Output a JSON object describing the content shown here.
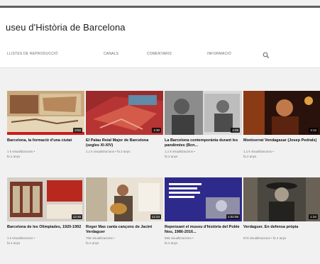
{
  "channel": {
    "title": "useu d'Història de Barcelona"
  },
  "tabs": [
    {
      "label": "LLISTES DE REPRODUCCIÓ"
    },
    {
      "label": "CANALS"
    },
    {
      "label": "COMENTARIS"
    },
    {
      "label": "INFORMACIÓ"
    }
  ],
  "section_label": "",
  "videos": [
    {
      "title": "Barcelona, la formació d'una ciutat",
      "meta1": "1 k visualitzacions •",
      "meta2": "fa 2 anys",
      "duration": "3:52",
      "icon": "old-map-thumbnail"
    },
    {
      "title": "El Palau Reial Major de Barcelona (segles XI-XIV)",
      "meta1": "1,1 k visualitzacions • fa 2 anys",
      "meta2": "",
      "duration": "4:30",
      "icon": "red-palace-thumbnail"
    },
    {
      "title": "La Barcelona contemporània durant les pandèmies (Bcn...",
      "meta1": "1,1 k visualitzacions •",
      "meta2": "fa 2 anys",
      "duration": "4:08",
      "icon": "historic-photo-thumbnail"
    },
    {
      "title": "Montserrat Vendagasar (Josep Pedrals)",
      "meta1": "1,1 k visualitzacions •",
      "meta2": "fa 2 anys",
      "duration": "4:12",
      "icon": "dark-portrait-thumbnail"
    },
    {
      "title": "Barcelona de les Olimpiades, 1920-1992",
      "meta1": "1 k visualitzacions •",
      "meta2": "fa 2 anys",
      "duration": "12:46",
      "icon": "exhibition-thumbnail"
    },
    {
      "title": "Roger Mas canta cançons de Jacint Verdaguer",
      "meta1": "708 visualitzacions •",
      "meta2": "fa 2 anys",
      "duration": "12:23",
      "icon": "guitar-player-thumbnail"
    },
    {
      "title": "Repensant el museu d'història del Poble Nou, 1986-2016...",
      "meta1": "665 visualitzacions •",
      "meta2": "fa 2 anys",
      "duration": "1:02:05",
      "icon": "conference-poster-thumbnail"
    },
    {
      "title": "Verdaguer. En defensa pròpia",
      "meta1": "673 visualitzacions • fa 2 anys",
      "meta2": "",
      "duration": "1:34",
      "icon": "bw-portrait-thumbnail"
    }
  ]
}
